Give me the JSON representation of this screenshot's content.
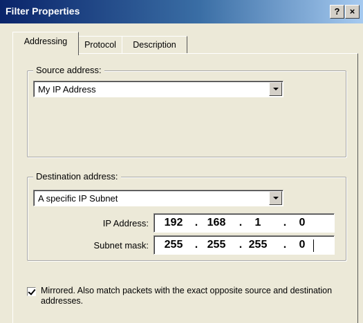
{
  "window": {
    "title": "Filter Properties",
    "help_label": "?",
    "close_label": "×"
  },
  "tabs": [
    {
      "label": "Addressing",
      "active": true
    },
    {
      "label": "Protocol",
      "active": false
    },
    {
      "label": "Description",
      "active": false
    }
  ],
  "source": {
    "legend": "Source address:",
    "selected": "My IP Address"
  },
  "destination": {
    "legend": "Destination address:",
    "selected": "A specific IP Subnet",
    "ip_label": "IP Address:",
    "ip_octets": [
      "192",
      "168",
      "1",
      "0"
    ],
    "mask_label": "Subnet mask:",
    "mask_octets": [
      "255",
      "255",
      "255",
      "0"
    ],
    "separator": "."
  },
  "mirrored": {
    "checked": true,
    "label": "Mirrored. Also match packets with the exact opposite source and destination addresses."
  },
  "colors": {
    "title_start": "#0a246a",
    "title_end": "#a6caf0",
    "dialog_bg": "#ece9d8"
  }
}
